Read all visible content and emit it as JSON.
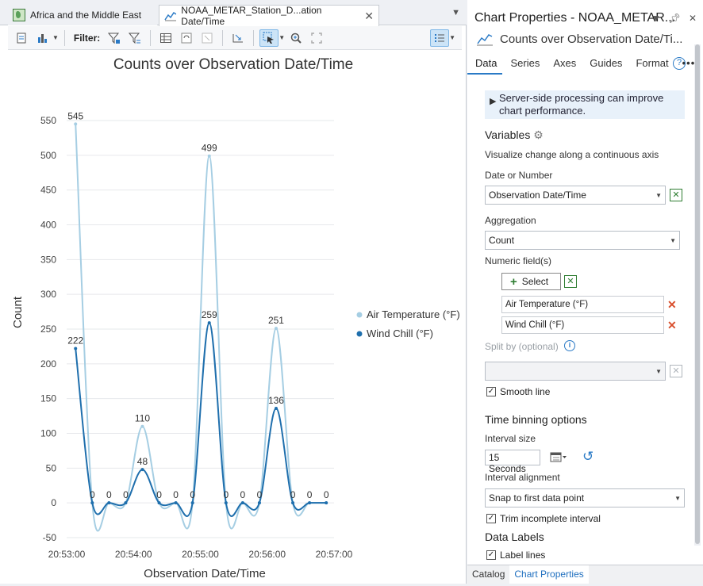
{
  "tabs": [
    {
      "label": "Africa and the Middle East",
      "icon": "map-icon"
    },
    {
      "label": "NOAA_METAR_Station_D...ation Date/Time",
      "icon": "line-chart-icon"
    }
  ],
  "toolbar": {
    "filter_label": "Filter:"
  },
  "right_panel": {
    "title": "Chart Properties - NOAA_METAR...",
    "subtitle": "Counts over Observation Date/Ti...",
    "tabs": [
      "Data",
      "Series",
      "Axes",
      "Guides",
      "Format"
    ],
    "more": "•••",
    "help": "?",
    "info_banner": "Server-side processing can improve chart performance.",
    "variables": {
      "title": "Variables",
      "desc": "Visualize change along a continuous axis",
      "date_label": "Date or Number",
      "date_value": "Observation Date/Time",
      "aggregation_label": "Aggregation",
      "aggregation_value": "Count",
      "numeric_label": "Numeric field(s)",
      "select_label": "Select",
      "fields": [
        "Air Temperature (°F)",
        "Wind Chill (°F)"
      ],
      "split_label": "Split by (optional)",
      "split_value": "",
      "smooth_label": "Smooth line"
    },
    "binning": {
      "title": "Time binning options",
      "interval_size_label": "Interval size",
      "interval_size_value": "15 Seconds",
      "alignment_label": "Interval alignment",
      "alignment_value": "Snap to first data point",
      "trim_label": "Trim incomplete interval"
    },
    "data_labels": {
      "title": "Data Labels",
      "label_lines": "Label lines"
    },
    "bottom_tabs": [
      "Catalog",
      "Chart Properties"
    ]
  },
  "colors": {
    "air_temp": "#a6cee3",
    "wind_chill": "#1f6fad",
    "accent": "#2a7ac6"
  },
  "chart_data": {
    "type": "line",
    "title": "Counts over Observation Date/Time",
    "xlabel": "Observation Date/Time",
    "ylabel": "Count",
    "ylim": [
      -50,
      550
    ],
    "yticks": [
      -50,
      0,
      50,
      100,
      150,
      200,
      250,
      300,
      350,
      400,
      450,
      500,
      550
    ],
    "xlim": [
      "20:53:00",
      "20:57:00"
    ],
    "xticks": [
      "20:53:00",
      "20:54:00",
      "20:55:00",
      "20:56:00",
      "20:57:00"
    ],
    "smooth": true,
    "legend_position": "right",
    "x": [
      "20:53:08",
      "20:53:23",
      "20:53:38",
      "20:53:53",
      "20:54:08",
      "20:54:23",
      "20:54:38",
      "20:54:53",
      "20:55:08",
      "20:55:23",
      "20:55:38",
      "20:55:53",
      "20:56:08",
      "20:56:23",
      "20:56:38",
      "20:56:53"
    ],
    "series": [
      {
        "name": "Air Temperature (°F)",
        "values": [
          545,
          0,
          0,
          0,
          110,
          0,
          0,
          0,
          499,
          0,
          0,
          0,
          251,
          0,
          0,
          0
        ]
      },
      {
        "name": "Wind Chill (°F)",
        "values": [
          222,
          0,
          0,
          0,
          48,
          0,
          0,
          0,
          259,
          0,
          0,
          0,
          136,
          0,
          0,
          0
        ]
      }
    ]
  }
}
